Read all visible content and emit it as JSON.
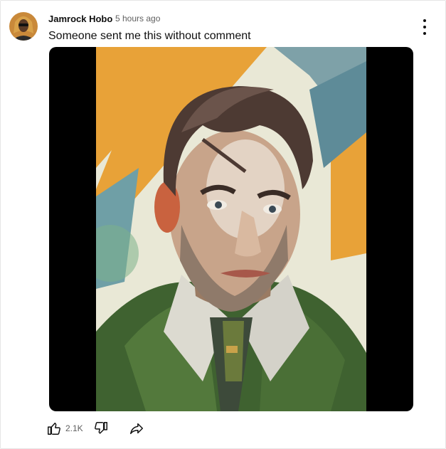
{
  "post": {
    "author": "Jamrock Hobo",
    "timestamp": "5 hours ago",
    "text": "Someone sent me this without comment",
    "avatar_icon": "user-avatar",
    "menu_icon": "more-vert-icon",
    "image_description_icon": "portrait-painting"
  },
  "actions": {
    "like_icon": "thumb-up-icon",
    "like_count": "2.1K",
    "dislike_icon": "thumb-down-icon",
    "share_icon": "share-icon"
  },
  "colors": {
    "text": "#0f0f0f",
    "muted": "#606060",
    "media_bg": "#000000"
  }
}
